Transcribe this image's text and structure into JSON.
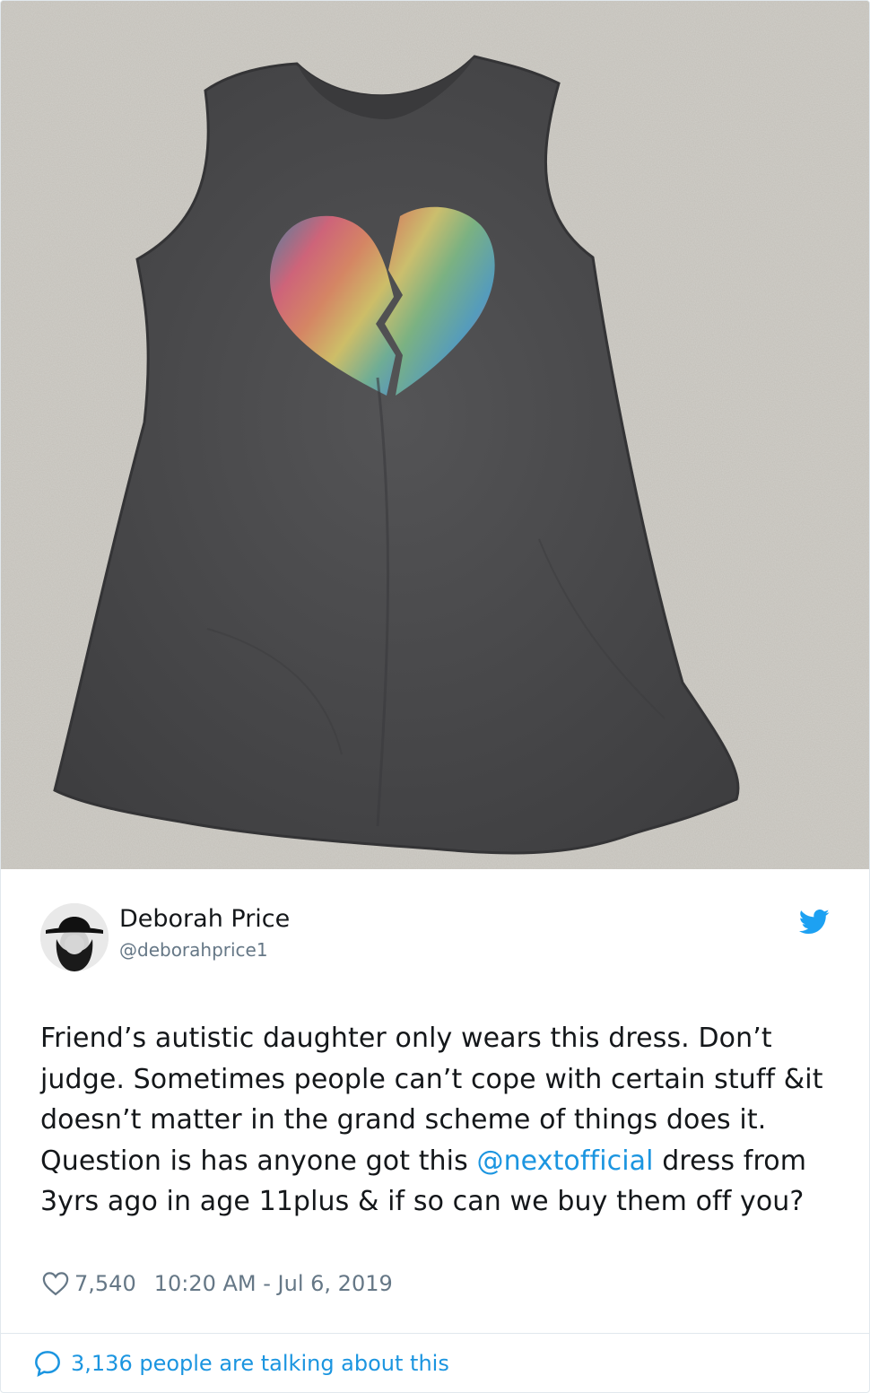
{
  "tweet": {
    "author_name": "Deborah Price",
    "author_handle": "@deborahprice1",
    "text_before_mention": "Friend’s autistic daughter only wears this dress. Don’t judge. Sometimes people can’t cope with certain stuff &it doesn’t matter in the grand scheme of things does it. Question is has anyone got this ",
    "mention": "@nextofficial",
    "text_after_mention": " dress from 3yrs ago in age 11plus & if so can we buy them off you?",
    "likes": "7,540",
    "timestamp": "10:20 AM - Jul 6, 2019",
    "talking_about": "3,136 people are talking about this"
  },
  "icons": {
    "brand": "twitter-bird-icon",
    "like": "heart-icon",
    "reply": "speech-bubble-icon"
  },
  "colors": {
    "accent": "#1b95e0",
    "secondary_text": "#657786",
    "primary_text": "#14171a",
    "twitter_blue": "#1da1f2",
    "dress": "#4a4a4c",
    "carpet": "#bdbab3"
  }
}
